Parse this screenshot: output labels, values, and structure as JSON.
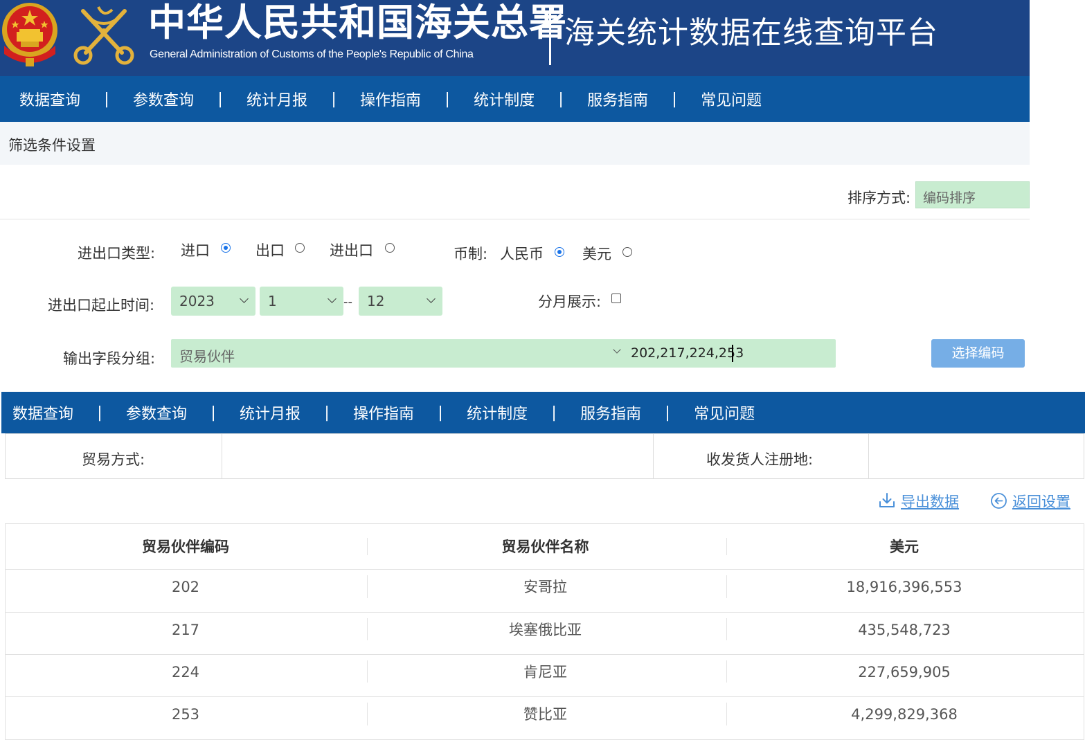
{
  "header": {
    "org_name_cn": "中华人民共和国海关总署",
    "org_name_en": "General Administration of Customs of the People's Republic of China",
    "platform_title": "海关统计数据在线查询平台",
    "emblem_icon": "national-emblem-icon",
    "customs_logo_icon": "customs-emblem-icon",
    "background_color": "#1c4587"
  },
  "nav": {
    "background_color": "#0d58a0",
    "items": [
      "数据查询",
      "参数查询",
      "统计月报",
      "操作指南",
      "统计制度",
      "服务指南",
      "常见问题"
    ],
    "separator": "|"
  },
  "filter": {
    "title": "筛选条件设置",
    "sort_label": "排序方式:",
    "sort_value": "编码排序",
    "trade_type_label": "进出口类型:",
    "trade_type_options": [
      "进口",
      "出口",
      "进出口"
    ],
    "trade_type_selected": "进口",
    "currency_label": "币制:",
    "currency_options": [
      "人民币",
      "美元"
    ],
    "currency_selected": "人民币",
    "period_label": "进出口起止时间:",
    "year": "2023",
    "start_month": "1",
    "period_separator": "--",
    "end_month": "12",
    "monthly_label": "分月展示:",
    "group_label": "输出字段分组:",
    "group_value": "贸易伙伴",
    "codes_value": "202,217,224,253",
    "choose_code_button": "选择编码",
    "field_color": "#c8ecd0",
    "button_color": "#76aee6"
  },
  "info": {
    "trade_mode_label": "贸易方式:",
    "trade_mode_value": "",
    "registration_label": "收发货人注册地:",
    "registration_value": ""
  },
  "actions": {
    "export_label": "导出数据",
    "export_icon": "download-icon",
    "back_label": "返回设置",
    "back_icon": "arrow-left-circle-icon",
    "link_color": "#4a90d9"
  },
  "results": {
    "columns": [
      "贸易伙伴编码",
      "贸易伙伴名称",
      "美元"
    ],
    "rows": [
      [
        "202",
        "安哥拉",
        "18,916,396,553"
      ],
      [
        "217",
        "埃塞俄比亚",
        "435,548,723"
      ],
      [
        "224",
        "肯尼亚",
        "227,659,905"
      ],
      [
        "253",
        "赞比亚",
        "4,299,829,368"
      ]
    ]
  }
}
